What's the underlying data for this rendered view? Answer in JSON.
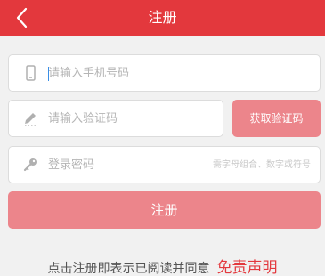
{
  "header": {
    "title": "注册",
    "back_icon": "chevron-left-icon",
    "background_color": "#e3383d"
  },
  "form": {
    "phone": {
      "placeholder": "请输入手机号码",
      "value": "",
      "icon": "phone-icon"
    },
    "code": {
      "placeholder": "请输入验证码",
      "value": "",
      "icon": "pencil-icon"
    },
    "get_code_label": "获取验证码",
    "password": {
      "placeholder": "登录密码",
      "value": "",
      "hint": "需字母组合、数字或符号",
      "icon": "key-icon"
    },
    "submit_label": "注册",
    "button_color": "#ec858b"
  },
  "agreement": {
    "text": "点击注册即表示已阅读并同意",
    "link_label": "免责声明",
    "link_color": "#e3383d"
  }
}
